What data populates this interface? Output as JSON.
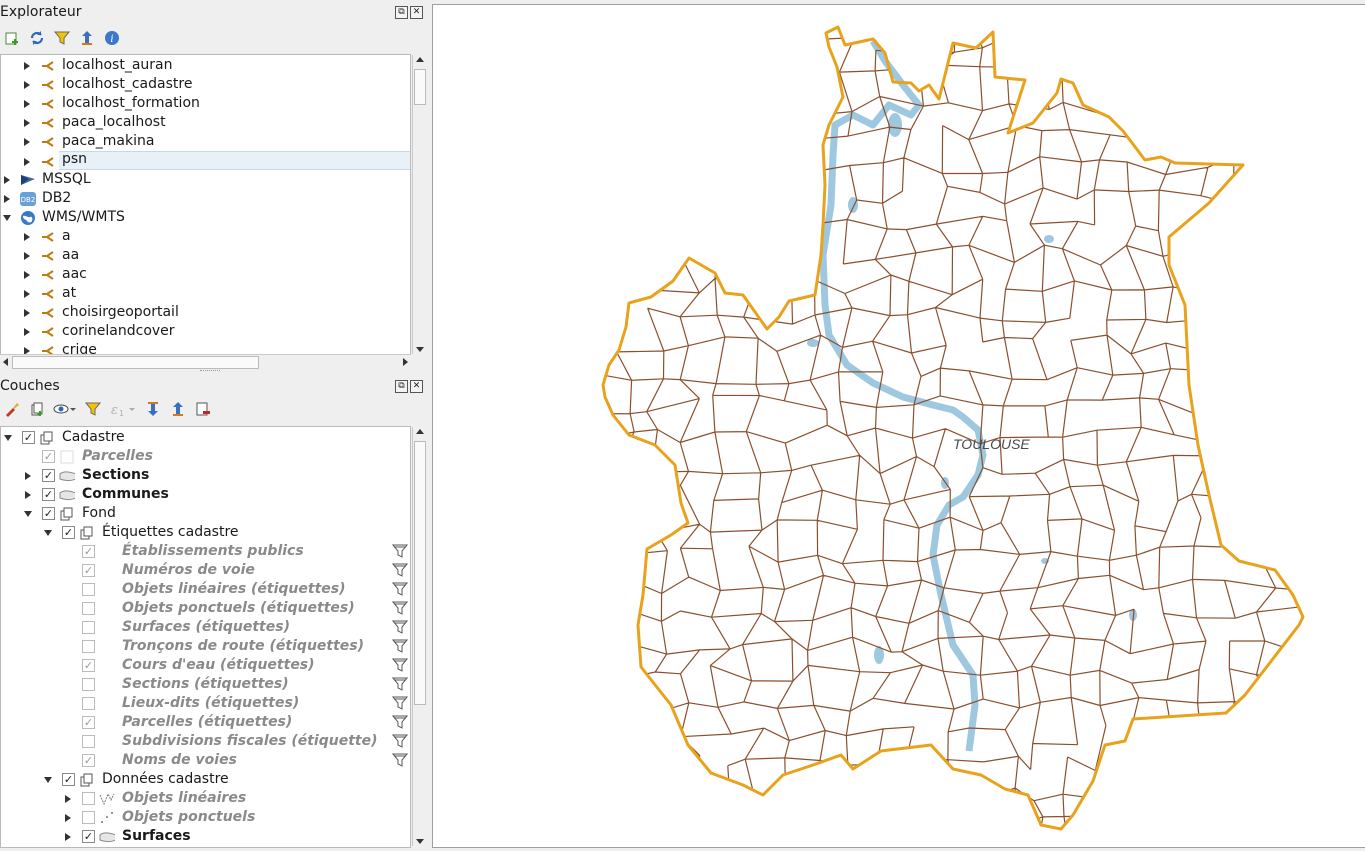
{
  "colors": {
    "commune_outline": "#e8a21b",
    "sections_lines": "#8b4f2e",
    "water": "#9ec8e0",
    "selection": "#e8f0f8"
  },
  "browser": {
    "title": "Explorateur",
    "toolbar_icons": [
      "add-layer-icon",
      "refresh-icon",
      "filter-icon",
      "collapse-all-icon",
      "info-icon"
    ],
    "items": [
      {
        "label": "localhost_auran",
        "icon": "connection-icon"
      },
      {
        "label": "localhost_cadastre",
        "icon": "connection-icon"
      },
      {
        "label": "localhost_formation",
        "icon": "connection-icon"
      },
      {
        "label": "paca_localhost",
        "icon": "connection-icon"
      },
      {
        "label": "paca_makina",
        "icon": "connection-icon"
      },
      {
        "label": "psn",
        "icon": "connection-icon",
        "selected": true
      },
      {
        "label": "MSSQL",
        "icon": "mssql-icon"
      },
      {
        "label": "DB2",
        "icon": "db2-icon"
      },
      {
        "label": "WMS/WMTS",
        "icon": "wms-icon"
      },
      {
        "label": "a",
        "icon": "connection-icon"
      },
      {
        "label": "aa",
        "icon": "connection-icon"
      },
      {
        "label": "aac",
        "icon": "connection-icon"
      },
      {
        "label": "at",
        "icon": "connection-icon"
      },
      {
        "label": "choisirgeoportail",
        "icon": "connection-icon"
      },
      {
        "label": "corinelandcover",
        "icon": "connection-icon"
      },
      {
        "label": "crige",
        "icon": "connection-icon"
      }
    ]
  },
  "layers": {
    "title": "Couches",
    "toolbar_icons": [
      "style-icon",
      "add-group-icon",
      "visibility-icon",
      "filter-layer-icon",
      "expression-icon",
      "expand-all-icon",
      "collapse-all-icon",
      "remove-layer-icon"
    ],
    "items": [
      {
        "label": "Cadastre",
        "checked": true
      },
      {
        "label": "Parcelles",
        "checked": true
      },
      {
        "label": "Sections",
        "checked": true
      },
      {
        "label": "Communes",
        "checked": true
      },
      {
        "label": "Fond",
        "checked": true
      },
      {
        "label": "Étiquettes cadastre",
        "checked": true
      },
      {
        "label": "Établissements publics",
        "checked": true
      },
      {
        "label": "Numéros de voie",
        "checked": true
      },
      {
        "label": "Objets linéaires (étiquettes)",
        "checked": false
      },
      {
        "label": "Objets ponctuels (étiquettes)",
        "checked": false
      },
      {
        "label": "Surfaces (étiquettes)",
        "checked": false
      },
      {
        "label": "Tronçons de route (étiquettes)",
        "checked": false
      },
      {
        "label": "Cours d'eau (étiquettes)",
        "checked": true
      },
      {
        "label": "Sections (étiquettes)",
        "checked": false
      },
      {
        "label": "Lieux-dits  (étiquettes)",
        "checked": false
      },
      {
        "label": "Parcelles (étiquettes)",
        "checked": true
      },
      {
        "label": "Subdivisions fiscales (étiquette)",
        "checked": false
      },
      {
        "label": "Noms de voies",
        "checked": true
      },
      {
        "label": "Données cadastre",
        "checked": true
      },
      {
        "label": "Objets linéaires",
        "checked": false
      },
      {
        "label": "Objets ponctuels",
        "checked": false
      },
      {
        "label": "Surfaces",
        "checked": true
      }
    ]
  },
  "map": {
    "city_label": "TOULOUSE"
  }
}
